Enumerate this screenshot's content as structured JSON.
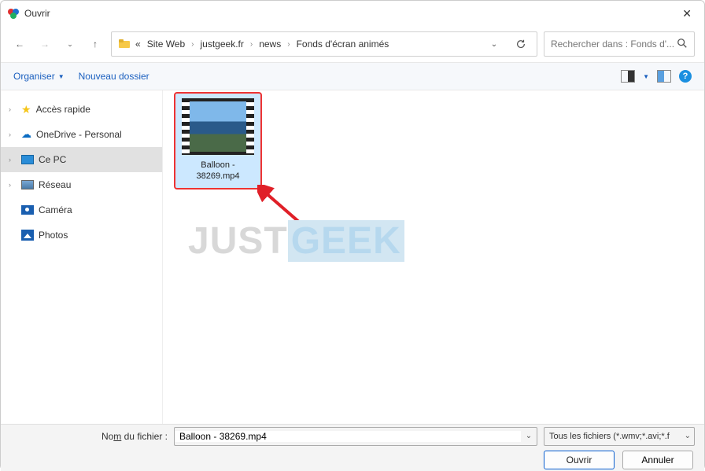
{
  "window": {
    "title": "Ouvrir"
  },
  "breadcrumbs": {
    "prefix": "«",
    "items": [
      "Site Web",
      "justgeek.fr",
      "news",
      "Fonds d'écran animés"
    ]
  },
  "search": {
    "placeholder": "Rechercher dans : Fonds d'..."
  },
  "cmdbar": {
    "organise": "Organiser",
    "new_folder": "Nouveau dossier"
  },
  "sidebar": {
    "items": [
      {
        "label": "Accès rapide"
      },
      {
        "label": "OneDrive - Personal"
      },
      {
        "label": "Ce PC"
      },
      {
        "label": "Réseau"
      },
      {
        "label": "Caméra"
      },
      {
        "label": "Photos"
      }
    ]
  },
  "files": {
    "selected": {
      "line1": "Balloon -",
      "line2": "38269.mp4"
    }
  },
  "watermark": {
    "part1": "JUST",
    "part2": "GEEK"
  },
  "footer": {
    "filename_label_pre": "No",
    "filename_label_u": "m",
    "filename_label_post": " du fichier :",
    "filename_value": "Balloon - 38269.mp4",
    "filter": "Tous les fichiers (*.wmv;*.avi;*.f",
    "open": "Ouvrir",
    "cancel": "Annuler"
  }
}
